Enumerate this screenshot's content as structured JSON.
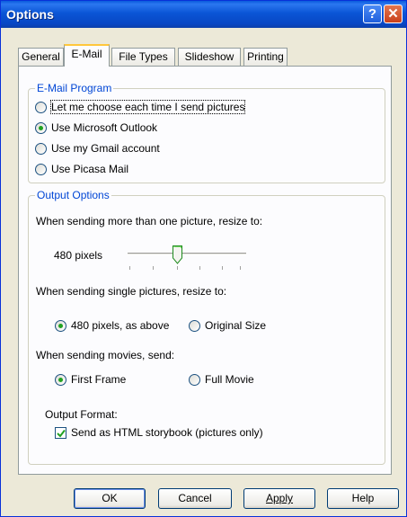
{
  "window": {
    "title": "Options"
  },
  "tabs": [
    {
      "label": "General"
    },
    {
      "label": "E-Mail"
    },
    {
      "label": "File Types"
    },
    {
      "label": "Slideshow"
    },
    {
      "label": "Printing"
    }
  ],
  "email_program": {
    "legend": "E-Mail Program",
    "options": [
      {
        "label": "Let me choose each time I send pictures",
        "selected": false
      },
      {
        "label": "Use Microsoft Outlook",
        "selected": true
      },
      {
        "label": "Use my Gmail account",
        "selected": false
      },
      {
        "label": "Use Picasa Mail",
        "selected": false
      }
    ]
  },
  "output_options": {
    "legend": "Output Options",
    "multi_label": "When sending more than one picture, resize to:",
    "slider_value_label": "480 pixels",
    "single_label": "When sending single pictures, resize to:",
    "single_options": [
      {
        "label": "480 pixels, as above",
        "selected": true
      },
      {
        "label": "Original Size",
        "selected": false
      }
    ],
    "movies_label": "When sending movies, send:",
    "movie_options": [
      {
        "label": "First Frame",
        "selected": true
      },
      {
        "label": "Full Movie",
        "selected": false
      }
    ],
    "format_label": "Output Format:",
    "format_checkbox": {
      "label": "Send as HTML storybook (pictures only)",
      "checked": true
    }
  },
  "buttons": {
    "ok": "OK",
    "cancel": "Cancel",
    "apply": "Apply",
    "help": "Help"
  },
  "colors": {
    "title_bar": "#0a55d6",
    "group_legend": "#0046d5",
    "radio_dot": "#21a121",
    "check_mark": "#21a121"
  }
}
